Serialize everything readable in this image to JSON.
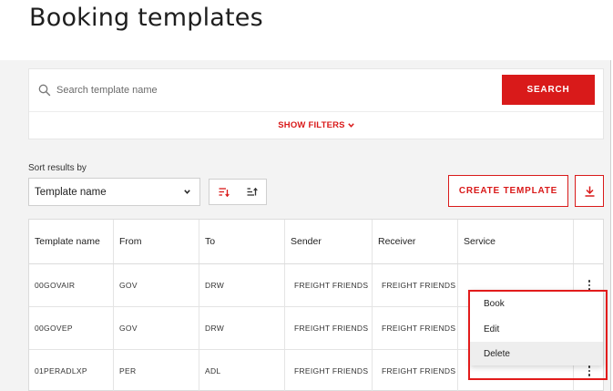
{
  "page": {
    "title": "Booking templates"
  },
  "search": {
    "placeholder": "Search template name",
    "value": "",
    "button_label": "SEARCH",
    "show_filters_label": "SHOW FILTERS",
    "search_icon": "search-icon",
    "filters_icon": "chevron-down-icon"
  },
  "sort": {
    "label": "Sort results by",
    "selected": "Template name",
    "dropdown_icon": "chevron-down-icon",
    "descending_icon": "sort-descending-icon",
    "ascending_icon": "sort-ascending-icon"
  },
  "actions": {
    "create_label": "CREATE TEMPLATE",
    "download_icon": "download-icon"
  },
  "table": {
    "columns": [
      "Template name",
      "From",
      "To",
      "Sender",
      "Receiver",
      "Service",
      ""
    ],
    "rows": [
      {
        "template_name": "00GOVAIR",
        "from": "GOV",
        "to": "DRW",
        "sender": "FREIGHT FRIENDS",
        "receiver": "FREIGHT FRIENDS",
        "service": ""
      },
      {
        "template_name": "00GOVEP",
        "from": "GOV",
        "to": "DRW",
        "sender": "FREIGHT FRIENDS",
        "receiver": "FREIGHT FRIENDS",
        "service": ""
      },
      {
        "template_name": "01PERADLXP",
        "from": "PER",
        "to": "ADL",
        "sender": "FREIGHT FRIENDS",
        "receiver": "FREIGHT FRIENDS",
        "service": ""
      }
    ],
    "row_menu_icon": "more-vertical-icon"
  },
  "context_menu": {
    "items": [
      "Book",
      "Edit",
      "Delete"
    ],
    "hovered_item": "Delete",
    "highlight_color": "#e21b1b"
  },
  "colors": {
    "accent": "#d91a1a",
    "background": "#f3f3f3",
    "card": "#ffffff"
  }
}
